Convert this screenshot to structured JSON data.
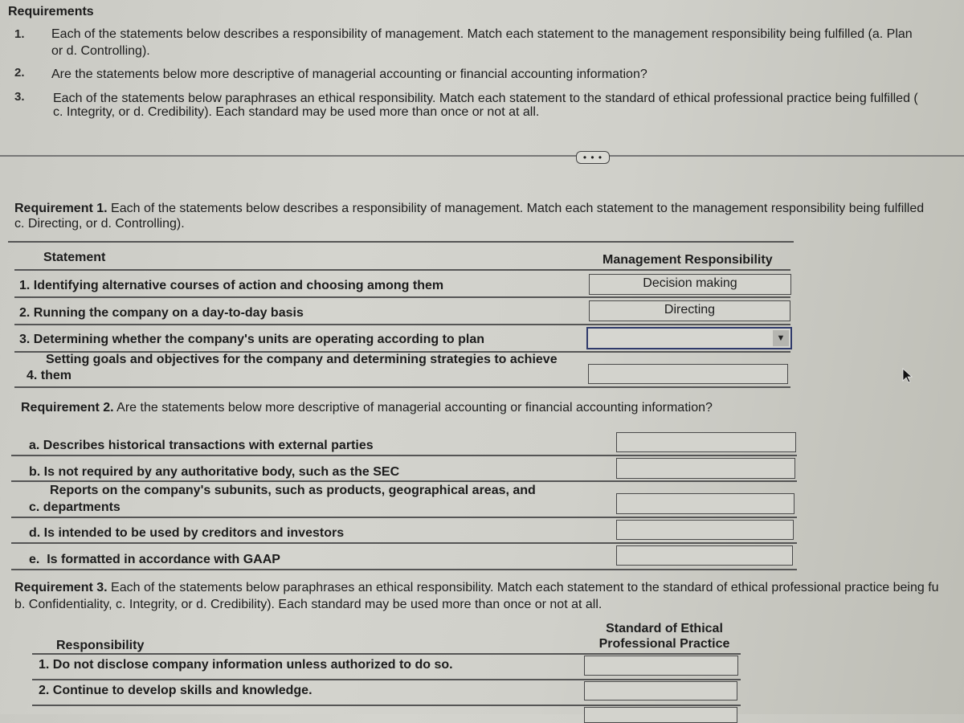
{
  "requirements": {
    "title": "Requirements",
    "items": [
      {
        "num": "1.",
        "line1": "Each of the statements below describes a responsibility of management. Match each statement to the management responsibility being fulfilled (a. Plan",
        "line2": "or d. Controlling)."
      },
      {
        "num": "2.",
        "line1": "Are the statements below more descriptive of managerial accounting or financial accounting information?",
        "line2": ""
      },
      {
        "num": "3.",
        "line1": "Each of the statements below paraphrases an ethical responsibility. Match each statement to the standard of ethical professional practice being fulfilled (",
        "line2": "c. Integrity, or d. Credibility). Each standard may be used more than once or not at all."
      }
    ]
  },
  "expand_button": {
    "label": "• • •"
  },
  "req1": {
    "heading_bold": "Requirement 1.",
    "heading_line1": " Each of the statements below describes a responsibility of management. Match each statement to the management responsibility being fulfilled",
    "heading_line2": "c. Directing, or d. Controlling).",
    "col_statement": "Statement",
    "col_responsibility": "Management Responsibility",
    "rows": [
      {
        "num": "1.",
        "text": "Identifying alternative courses of action and choosing among them",
        "text2": "",
        "value": "Decision making"
      },
      {
        "num": "2.",
        "text": "Running the company on a day-to-day basis",
        "text2": "",
        "value": "Directing"
      },
      {
        "num": "3.",
        "text": "Determining whether the company's units are operating according to plan",
        "text2": "",
        "value": ""
      },
      {
        "num": "4.",
        "text": "Setting goals and objectives for the company and determining strategies to achieve",
        "text2": "them",
        "value": ""
      }
    ]
  },
  "req2": {
    "heading_bold": "Requirement 2.",
    "heading_text": " Are the statements below more descriptive of managerial accounting or financial accounting information?",
    "rows": [
      {
        "letter": "a.",
        "text": "Describes historical transactions with external parties",
        "text2": "",
        "value": ""
      },
      {
        "letter": "b.",
        "text": "Is not required by any authoritative body, such as the SEC",
        "text2": "",
        "value": ""
      },
      {
        "letter": "c.",
        "text": "Reports on the company's subunits, such as products, geographical areas, and",
        "text2": "departments",
        "value": ""
      },
      {
        "letter": "d.",
        "text": "Is intended to be used by creditors and investors",
        "text2": "",
        "value": ""
      },
      {
        "letter": "e.",
        "text": "Is formatted in accordance with GAAP",
        "text2": "",
        "value": ""
      }
    ]
  },
  "req3": {
    "heading_bold": "Requirement 3.",
    "heading_line1": " Each of the statements below paraphrases an ethical responsibility. Match each statement to the standard of ethical professional practice being fu",
    "heading_line2": "b. Confidentiality, c. Integrity, or d. Credibility). Each standard may be used more than once or not at all.",
    "col_responsibility": "Responsibility",
    "col_standard_line1": "Standard of Ethical",
    "col_standard_line2": "Professional Practice",
    "rows": [
      {
        "num": "1.",
        "text": "Do not disclose company information unless authorized to do so.",
        "value": ""
      },
      {
        "num": "2.",
        "text": "Continue to develop skills and knowledge.",
        "value": ""
      }
    ]
  }
}
